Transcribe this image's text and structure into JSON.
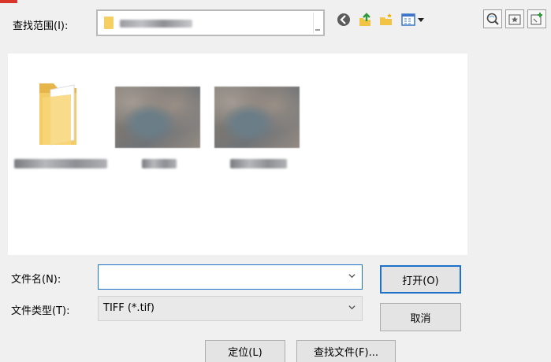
{
  "look_in": {
    "label": "查找范围(I):"
  },
  "toolbar": {
    "icons": [
      "back-icon",
      "up-folder-icon",
      "new-folder-icon",
      "view-menu-icon"
    ],
    "right_icons": [
      "search-globe-icon",
      "add-favorite-icon",
      "add-favorite-folder-icon"
    ]
  },
  "files": [
    {
      "type": "folder"
    },
    {
      "type": "image"
    },
    {
      "type": "image"
    }
  ],
  "filename": {
    "label": "文件名(N):",
    "value": ""
  },
  "filetype": {
    "label": "文件类型(T):",
    "selected": "TIFF (*.tif)"
  },
  "buttons": {
    "open": "打开(O)",
    "cancel": "取消",
    "locate": "定位(L)",
    "find_file": "查找文件(F)..."
  },
  "colors": {
    "accent": "#1e73c8",
    "window_bg": "#f0f0f0",
    "folder": "#f6cf62"
  }
}
